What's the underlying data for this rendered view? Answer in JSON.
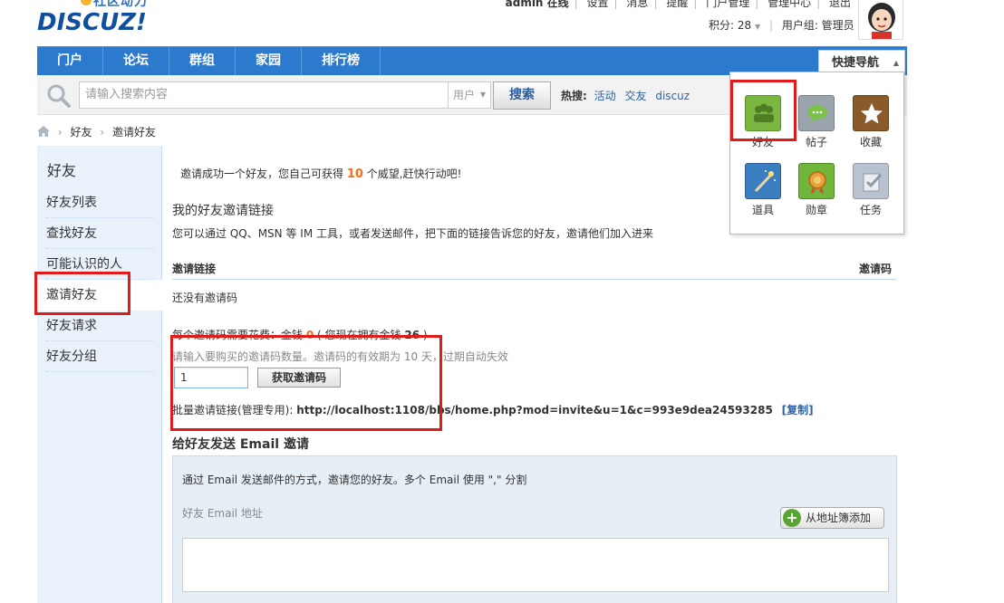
{
  "header": {
    "logo_cn": "社区动力",
    "logo_en": "DISCUZ!",
    "topbar": [
      "admin 在线",
      "设置",
      "消息",
      "提醒",
      "门户管理",
      "管理中心",
      "退出"
    ],
    "credits": "积分: 28",
    "usergroup": "用户组: 管理员"
  },
  "nav": {
    "items": [
      "门户",
      "论坛",
      "群组",
      "家园",
      "排行榜"
    ],
    "quick_nav": "快捷导航"
  },
  "search": {
    "placeholder": "请输入搜索内容",
    "type": "用户",
    "button": "搜索",
    "hot_label": "热搜:",
    "hot_terms": [
      "活动",
      "交友",
      "discuz"
    ]
  },
  "breadcrumb": [
    "好友",
    "邀请好友"
  ],
  "sidebar": {
    "title": "好友",
    "items": [
      "好友列表",
      "查找好友",
      "可能认识的人",
      "邀请好友",
      "好友请求",
      "好友分组"
    ]
  },
  "main": {
    "notice_pre": "邀请成功一个好友，您自己可获得",
    "notice_num": "10",
    "notice_post": "个威望,赶快行动吧!",
    "invite_title": "我的好友邀请链接",
    "invite_desc": "您可以通过 QQ、MSN 等 IM 工具，或者发送邮件，把下面的链接告诉您的好友，邀请他们加入进来",
    "th_left": "邀请链接",
    "th_right": "邀请码",
    "no_code": "还没有邀请码",
    "cost_pre": "每个邀请码需要花费：金钱",
    "cost_num": "0",
    "cost_mid": "( 您现在拥有金钱",
    "cost_have": "26",
    "cost_post": ")",
    "buy_hint": "请输入要购买的邀请码数量。邀请码的有效期为 10 天，过期自动失效",
    "qty_value": "1",
    "get_code_button": "获取邀请码",
    "batch_label": "批量邀请链接(管理专用):",
    "batch_url": "http://localhost:1108/bbs/home.php?mod=invite&u=1&c=993e9dea24593285",
    "copy": "[复制]",
    "email_title": "给好友发送 Email 邀请",
    "email_desc": "通过 Email 发送邮件的方式，邀请您的好友。多个 Email 使用 \",\" 分割",
    "email_label": "好友 Email 地址",
    "addr_button": "从地址簿添加"
  },
  "quick_nav_panel": {
    "items": [
      {
        "label": "好友",
        "color": "#7ab640"
      },
      {
        "label": "帖子",
        "color": "#9aa4ad"
      },
      {
        "label": "收藏",
        "color": "#8b5a2b"
      },
      {
        "label": "道具",
        "color": "#3b7fc1"
      },
      {
        "label": "勋章",
        "color": "#6fb63a"
      },
      {
        "label": "任务",
        "color": "#b9c3cf"
      }
    ]
  }
}
